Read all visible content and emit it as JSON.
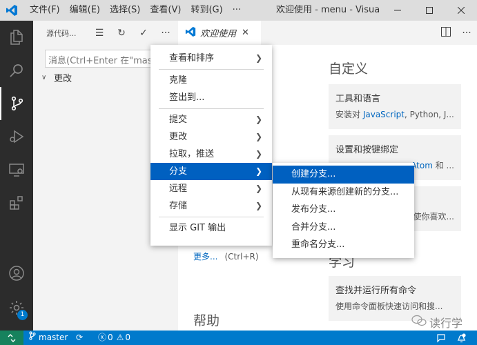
{
  "titlebar": {
    "menus": [
      "文件(F)",
      "编辑(E)",
      "选择(S)",
      "查看(V)",
      "转到(G)",
      "···"
    ],
    "window_title": "欢迎使用 - menu - Visual ..."
  },
  "activitybar": {
    "badge": "1"
  },
  "sidebar": {
    "title": "源代码...",
    "commit_placeholder": "消息(Ctrl+Enter 在\"master\"提交)",
    "changes_label": "更改"
  },
  "tab": {
    "label": "欢迎使用",
    "close": "✕"
  },
  "welcome": {
    "customize_heading": "自定义",
    "card1_title": "工具和语言",
    "card1_desc_prefix": "安装对 ",
    "card1_desc_link": "JavaScript",
    "card1_desc_suffix": ", Python, J...",
    "card2_title": "设置和按键绑定",
    "card2_desc_link": "Atom",
    "card2_desc_suffix": " 和 ...",
    "card3_desc": "使你喜欢...",
    "learn_heading": "学习",
    "card4_title": "查找并运行所有命令",
    "card4_desc": "使用命令面板快速访问和搜...",
    "more_link": "更多...",
    "more_shortcut": "(Ctrl+R)",
    "help_heading": "帮助"
  },
  "menu": {
    "items": [
      {
        "label": "查看和排序",
        "submenu": true
      },
      {
        "label": "克隆",
        "submenu": false
      },
      {
        "label": "签出到...",
        "submenu": false
      },
      {
        "label": "提交",
        "submenu": true
      },
      {
        "label": "更改",
        "submenu": true
      },
      {
        "label": "拉取，推送",
        "submenu": true
      },
      {
        "label": "分支",
        "submenu": true
      },
      {
        "label": "远程",
        "submenu": true
      },
      {
        "label": "存储",
        "submenu": true
      },
      {
        "label": "显示 GIT 输出",
        "submenu": false
      }
    ]
  },
  "submenu": {
    "items": [
      "创建分支...",
      "从现有来源创建新的分支...",
      "发布分支...",
      "合并分支...",
      "重命名分支..."
    ]
  },
  "statusbar": {
    "branch": "master",
    "errors": "0",
    "warnings": "0"
  },
  "watermark": {
    "text": "读行学"
  },
  "colors": {
    "accent": "#007acc",
    "menu_highlight": "#0060c0",
    "activitybar": "#2c2c2c",
    "remote": "#16825d"
  }
}
